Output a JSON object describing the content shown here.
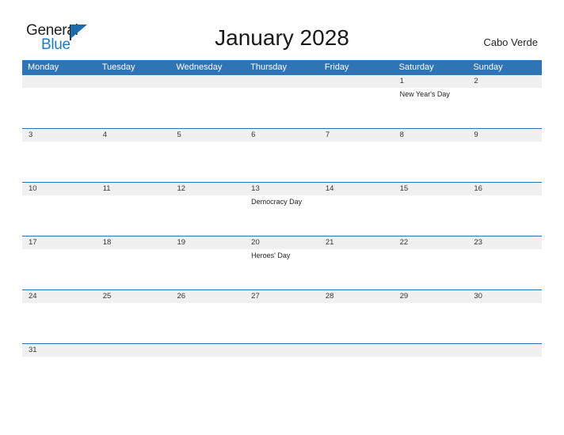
{
  "brand": {
    "name_part1": "General",
    "name_part2": "Blue",
    "flag_icon": "triangle-flag-icon",
    "accent_color": "#1d7cc4"
  },
  "header": {
    "title": "January 2028",
    "country": "Cabo Verde"
  },
  "theme": {
    "header_blue": "#2f74b5",
    "date_band_gray": "#f0f0f0",
    "divider_blue": "#2f74b5",
    "text_dark": "#231f20"
  },
  "calendar": {
    "weekdays": [
      "Monday",
      "Tuesday",
      "Wednesday",
      "Thursday",
      "Friday",
      "Saturday",
      "Sunday"
    ],
    "weeks": [
      {
        "days": [
          {
            "date": "",
            "event": ""
          },
          {
            "date": "",
            "event": ""
          },
          {
            "date": "",
            "event": ""
          },
          {
            "date": "",
            "event": ""
          },
          {
            "date": "",
            "event": ""
          },
          {
            "date": "1",
            "event": "New Year's Day"
          },
          {
            "date": "2",
            "event": ""
          }
        ]
      },
      {
        "days": [
          {
            "date": "3",
            "event": ""
          },
          {
            "date": "4",
            "event": ""
          },
          {
            "date": "5",
            "event": ""
          },
          {
            "date": "6",
            "event": ""
          },
          {
            "date": "7",
            "event": ""
          },
          {
            "date": "8",
            "event": ""
          },
          {
            "date": "9",
            "event": ""
          }
        ]
      },
      {
        "days": [
          {
            "date": "10",
            "event": ""
          },
          {
            "date": "11",
            "event": ""
          },
          {
            "date": "12",
            "event": ""
          },
          {
            "date": "13",
            "event": "Democracy Day"
          },
          {
            "date": "14",
            "event": ""
          },
          {
            "date": "15",
            "event": ""
          },
          {
            "date": "16",
            "event": ""
          }
        ]
      },
      {
        "days": [
          {
            "date": "17",
            "event": ""
          },
          {
            "date": "18",
            "event": ""
          },
          {
            "date": "19",
            "event": ""
          },
          {
            "date": "20",
            "event": "Heroes' Day"
          },
          {
            "date": "21",
            "event": ""
          },
          {
            "date": "22",
            "event": ""
          },
          {
            "date": "23",
            "event": ""
          }
        ]
      },
      {
        "days": [
          {
            "date": "24",
            "event": ""
          },
          {
            "date": "25",
            "event": ""
          },
          {
            "date": "26",
            "event": ""
          },
          {
            "date": "27",
            "event": ""
          },
          {
            "date": "28",
            "event": ""
          },
          {
            "date": "29",
            "event": ""
          },
          {
            "date": "30",
            "event": ""
          }
        ]
      },
      {
        "days": [
          {
            "date": "31",
            "event": ""
          },
          {
            "date": "",
            "event": ""
          },
          {
            "date": "",
            "event": ""
          },
          {
            "date": "",
            "event": ""
          },
          {
            "date": "",
            "event": ""
          },
          {
            "date": "",
            "event": ""
          },
          {
            "date": "",
            "event": ""
          }
        ]
      }
    ]
  }
}
